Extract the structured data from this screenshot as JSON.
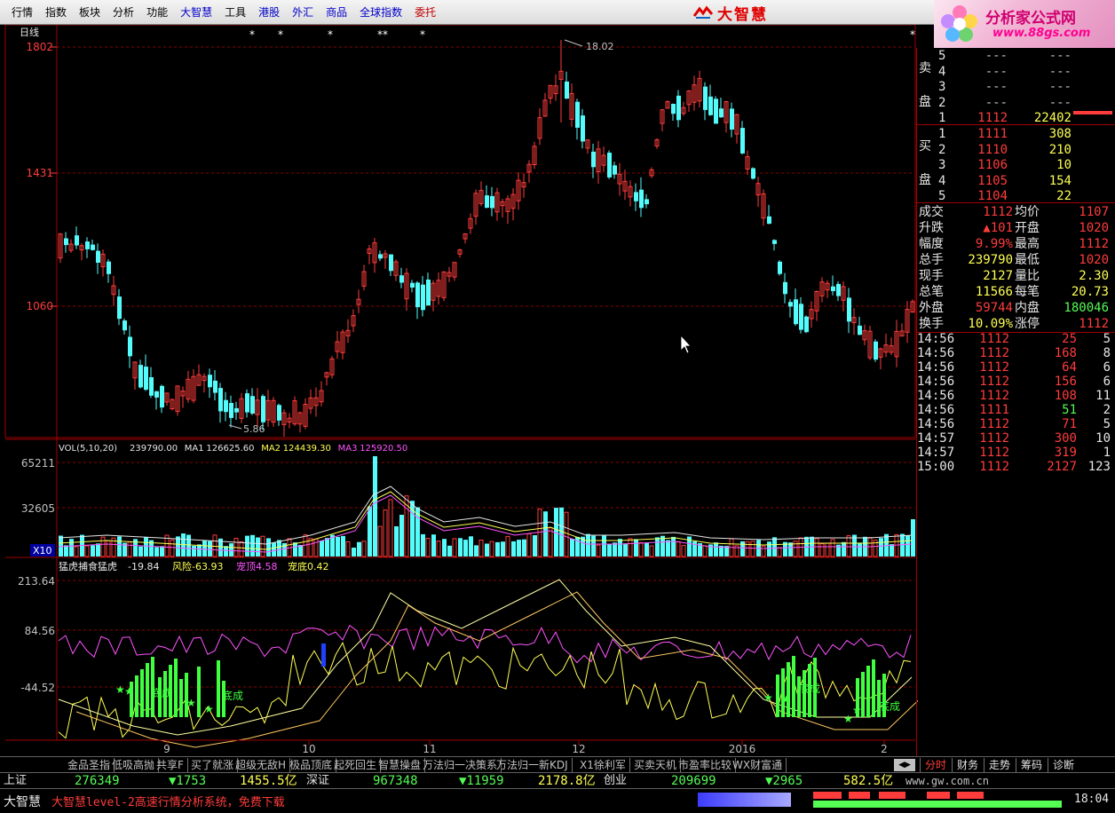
{
  "menu": {
    "items": [
      {
        "label": "行情",
        "style": "normal"
      },
      {
        "label": "指数",
        "style": "normal"
      },
      {
        "label": "板块",
        "style": "normal"
      },
      {
        "label": "分析",
        "style": "normal"
      },
      {
        "label": "功能",
        "style": "normal"
      },
      {
        "label": "大智慧",
        "style": "blue"
      },
      {
        "label": "工具",
        "style": "normal"
      },
      {
        "label": "港股",
        "style": "blue"
      },
      {
        "label": "外汇",
        "style": "blue"
      },
      {
        "label": "商品",
        "style": "blue"
      },
      {
        "label": "全球指数",
        "style": "blue"
      },
      {
        "label": "委托",
        "style": "red"
      }
    ],
    "brand": "大智慧",
    "site_title": "分析家公式网",
    "site_url": "www.88gs.com"
  },
  "main_chart": {
    "period_label": "日线",
    "y_ticks": [
      "1802",
      "1431",
      "1060"
    ],
    "high_label": "18.02",
    "low_label": "5.86",
    "code_fragment": "00",
    "colors": {
      "up": "#ff3c3c",
      "down": "#54fcfc",
      "grid": "#8c0000"
    }
  },
  "volume_panel": {
    "title": "VOL(5,10,20)",
    "values": [
      {
        "label": "239790.00",
        "color": "#e6e6e6"
      },
      {
        "label": "MA1",
        "color": "#e6e6e6"
      },
      {
        "label": "126625.60",
        "color": "#e6e6e6"
      },
      {
        "label": "MA2",
        "color": "#ffff54"
      },
      {
        "label": "124439.30",
        "color": "#ffff54"
      },
      {
        "label": "MA3",
        "color": "#ff54ff"
      },
      {
        "label": "125920.50",
        "color": "#ff54ff"
      }
    ],
    "y_ticks": [
      "65211",
      "32605"
    ],
    "unit_label": "X10"
  },
  "indicator_panel": {
    "title": "猛虎捕食猛虎",
    "values": [
      {
        "label": "-19.84",
        "color": "#e6e6e6"
      },
      {
        "label": "风险",
        "color": "#ffff54"
      },
      {
        "label": "-63.93",
        "color": "#ffff54"
      },
      {
        "label": "宠顶",
        "color": "#ff54ff"
      },
      {
        "label": "4.58",
        "color": "#ff54ff"
      },
      {
        "label": "宠底",
        "color": "#ffff54"
      },
      {
        "label": "0.42",
        "color": "#ffff54"
      }
    ],
    "y_ticks": [
      "213.64",
      "84.56",
      "-44.52"
    ],
    "signal_text": "底成"
  },
  "x_axis": {
    "labels": [
      "9",
      "10",
      "11",
      "12",
      "2016",
      "2"
    ]
  },
  "orderbook": {
    "sell_label_1": "卖",
    "sell_label_2": "盘",
    "buy_label_1": "买",
    "buy_label_2": "盘",
    "sells": [
      {
        "level": "5",
        "price": "---",
        "vol": "---"
      },
      {
        "level": "4",
        "price": "---",
        "vol": "---"
      },
      {
        "level": "3",
        "price": "---",
        "vol": "---"
      },
      {
        "level": "2",
        "price": "---",
        "vol": "---"
      },
      {
        "level": "1",
        "price": "1112",
        "vol": "22402"
      }
    ],
    "buys": [
      {
        "level": "1",
        "price": "1111",
        "vol": "308"
      },
      {
        "level": "2",
        "price": "1110",
        "vol": "210"
      },
      {
        "level": "3",
        "price": "1106",
        "vol": "10"
      },
      {
        "level": "4",
        "price": "1105",
        "vol": "154"
      },
      {
        "level": "5",
        "price": "1104",
        "vol": "22"
      }
    ]
  },
  "quote": {
    "rows": [
      {
        "l1": "成交",
        "v1": "1112",
        "c1": "#ff3c3c",
        "l2": "均价",
        "v2": "1107",
        "c2": "#ff3c3c"
      },
      {
        "l1": "升跌",
        "v1": "▲101",
        "c1": "#ff3c3c",
        "l2": "开盘",
        "v2": "1020",
        "c2": "#ff3c3c"
      },
      {
        "l1": "幅度",
        "v1": "9.99%",
        "c1": "#ff3c3c",
        "l2": "最高",
        "v2": "1112",
        "c2": "#ff3c3c"
      },
      {
        "l1": "总手",
        "v1": "239790",
        "c1": "#ffff54",
        "l2": "最低",
        "v2": "1020",
        "c2": "#ff3c3c"
      },
      {
        "l1": "现手",
        "v1": "2127",
        "c1": "#ffff54",
        "l2": "量比",
        "v2": "2.30",
        "c2": "#ffff54"
      },
      {
        "l1": "总笔",
        "v1": "11566",
        "c1": "#ffff54",
        "l2": "每笔",
        "v2": "20.73",
        "c2": "#ffff54"
      },
      {
        "l1": "外盘",
        "v1": "59744",
        "c1": "#ff3c3c",
        "l2": "内盘",
        "v2": "180046",
        "c2": "#54fc54"
      },
      {
        "l1": "换手",
        "v1": "10.09%",
        "c1": "#ffff54",
        "l2": "涨停",
        "v2": "1112",
        "c2": "#ff3c3c"
      }
    ]
  },
  "ticks": [
    {
      "time": "14:56",
      "price": "1112",
      "pc": "#ff3c3c",
      "vol": "25",
      "vc": "#ff3c3c",
      "n": "5"
    },
    {
      "time": "14:56",
      "price": "1112",
      "pc": "#ff3c3c",
      "vol": "168",
      "vc": "#ff3c3c",
      "n": "8"
    },
    {
      "time": "14:56",
      "price": "1112",
      "pc": "#ff3c3c",
      "vol": "64",
      "vc": "#ff3c3c",
      "n": "6"
    },
    {
      "time": "14:56",
      "price": "1112",
      "pc": "#ff3c3c",
      "vol": "156",
      "vc": "#ff3c3c",
      "n": "6"
    },
    {
      "time": "14:56",
      "price": "1112",
      "pc": "#ff3c3c",
      "vol": "108",
      "vc": "#ff3c3c",
      "n": "11"
    },
    {
      "time": "14:56",
      "price": "1111",
      "pc": "#ff3c3c",
      "vol": "51",
      "vc": "#54fc54",
      "n": "2"
    },
    {
      "time": "14:56",
      "price": "1112",
      "pc": "#ff3c3c",
      "vol": "71",
      "vc": "#ff3c3c",
      "n": "5"
    },
    {
      "time": "14:57",
      "price": "1112",
      "pc": "#ff3c3c",
      "vol": "300",
      "vc": "#ff3c3c",
      "n": "10"
    },
    {
      "time": "14:57",
      "price": "1112",
      "pc": "#ff3c3c",
      "vol": "319",
      "vc": "#ff3c3c",
      "n": "1"
    },
    {
      "time": "15:00",
      "price": "1112",
      "pc": "#ff3c3c",
      "vol": "2127",
      "vc": "#ff3c3c",
      "n": "123"
    }
  ],
  "bottom_tabs": [
    "金品圣指",
    "低吸高抛",
    "共享F",
    "买了就涨",
    "超级无敌H",
    "极品顶底",
    "起死回生",
    "智慧操盘",
    "万法归一决策系",
    "万法归一新KDJ",
    "X1徐利军",
    "买卖天机",
    "市盈率比较",
    "WX财富通"
  ],
  "right_tabs": [
    {
      "label": "分时",
      "active": true
    },
    {
      "label": "财务",
      "active": false
    },
    {
      "label": "走势",
      "active": false
    },
    {
      "label": "筹码",
      "active": false
    },
    {
      "label": "诊断",
      "active": false
    }
  ],
  "index_bar": {
    "sh_name": "上证",
    "sh_value": "276349",
    "sh_change": "▼1753",
    "sh_amount": "1455.5亿",
    "sz_name": "深证",
    "sz_value": "967348",
    "sz_change": "▼11959",
    "sz_amount": "2178.8亿",
    "cy_name": "创业",
    "cy_value": "209699",
    "cy_change": "▼2965",
    "cy_amount": "582.5亿",
    "site": "www.gw.com.cn"
  },
  "status": {
    "app": "大智慧",
    "ticker": "大智慧level-2高速行情分析系统，免费下载",
    "time": "18:04"
  }
}
